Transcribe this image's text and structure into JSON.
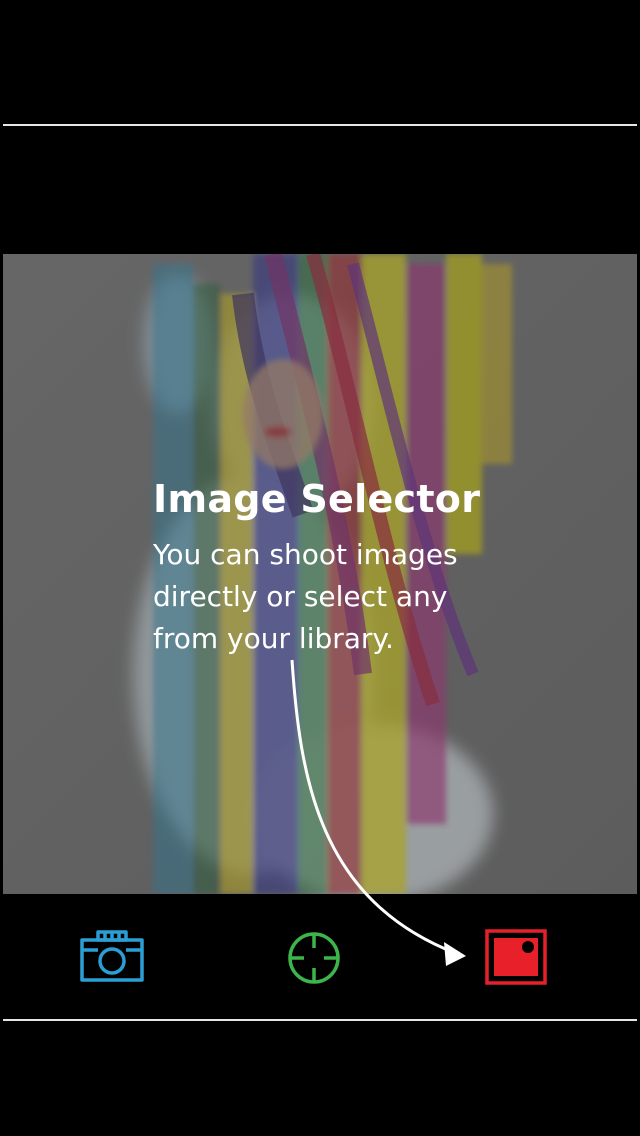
{
  "coach_mark": {
    "title": "Image Selector",
    "body_lines": [
      "You can shoot images",
      "directly or select any",
      "from your library."
    ]
  },
  "toolbar": {
    "camera": {
      "icon": "camera-icon",
      "color": "#2a9fd6"
    },
    "target": {
      "icon": "crosshair-icon",
      "color": "#3cb54a"
    },
    "library": {
      "icon": "photo-library-icon",
      "color": "#e8202a"
    }
  },
  "colors": {
    "background": "#000000",
    "divider": "#e6e6e6",
    "coach_text": "#ffffff"
  }
}
